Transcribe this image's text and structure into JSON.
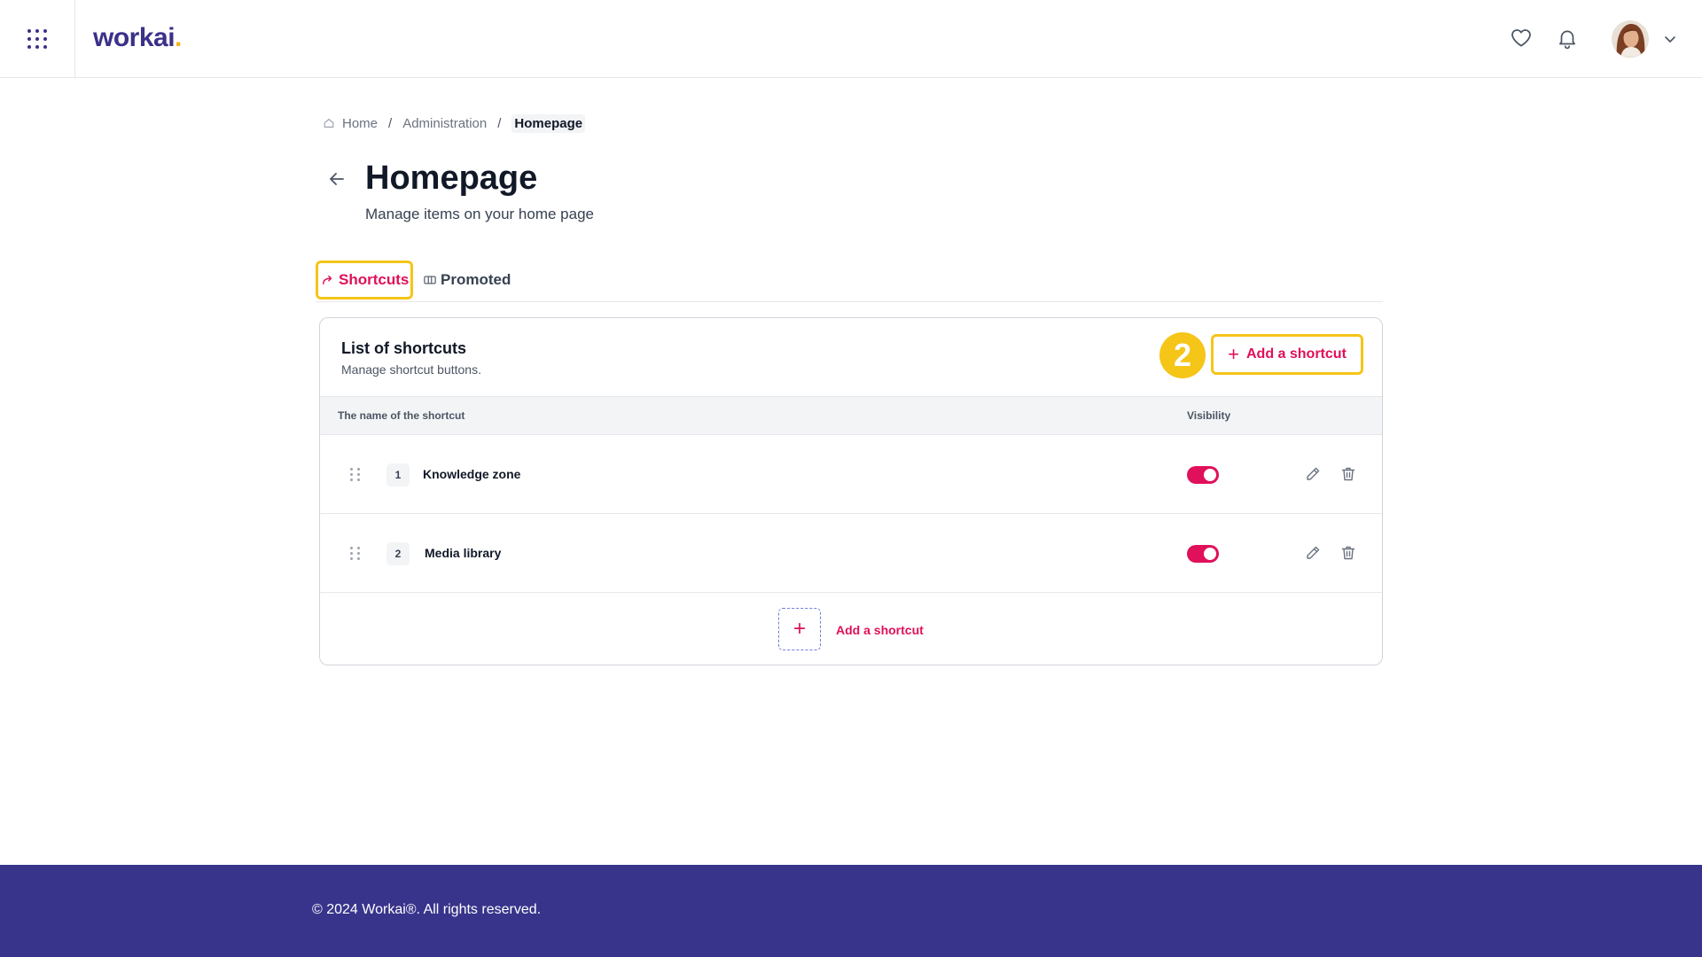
{
  "header": {
    "logo_text": "workai",
    "logo_dot": ".",
    "icons": [
      "apps-grid-icon",
      "heart-icon",
      "bell-icon",
      "chevron-down-icon"
    ],
    "accent_color": "#3a3189",
    "highlight_color": "#f5b51b"
  },
  "breadcrumb": {
    "items": [
      "Home",
      "Administration",
      "Homepage"
    ],
    "separator": "/"
  },
  "page": {
    "title": "Homepage",
    "subtitle": "Manage items on your home page"
  },
  "tabs": [
    {
      "label": "Shortcuts",
      "active": true,
      "icon": "share-arrow-icon"
    },
    {
      "label": "Promoted",
      "active": false,
      "icon": "columns-icon"
    }
  ],
  "card": {
    "title": "List of shortcuts",
    "subtitle": "Manage shortcut buttons.",
    "step_number": "2",
    "add_button_label": "Add a shortcut",
    "columns": [
      "The name of the shortcut",
      "Visibility"
    ],
    "rows": [
      {
        "index": "1",
        "name": "Knowledge zone",
        "visible": true
      },
      {
        "index": "2",
        "name": "Media library",
        "visible": true
      }
    ],
    "add_link_label": "Add a shortcut"
  },
  "footer": {
    "copyright": "© 2024 Workai®. All rights reserved.",
    "background_color": "#38348b"
  },
  "colors": {
    "primary_pink": "#e0105a",
    "annotation_yellow": "#f5c518"
  }
}
